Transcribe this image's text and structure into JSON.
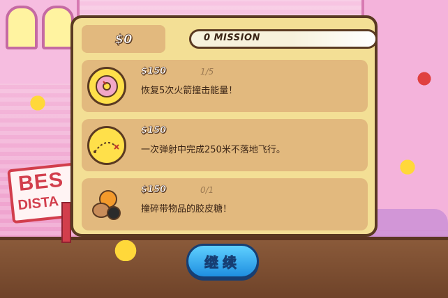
{
  "background_sign": {
    "line1": "BES",
    "line2": "DISTA"
  },
  "header": {
    "money": "$0",
    "missions_label": "0 MISSION"
  },
  "missions": [
    {
      "icon": "donut-icon",
      "reward": "$150",
      "progress": "1/5",
      "description": "恢复5次火箭撞击能量！"
    },
    {
      "icon": "trajectory-icon",
      "reward": "$150",
      "progress": "",
      "description": "一次弹射中完成250米不落地飞行。"
    },
    {
      "icon": "bomb-candy-icon",
      "reward": "$150",
      "progress": "0/1",
      "description": "撞碎带物品的胶皮糖！"
    }
  ],
  "continue_button": {
    "label": "继续"
  },
  "colors": {
    "panel": "#f3df95",
    "row": "#e2b97e",
    "outline": "#5a3a22",
    "button": "#2aa6ef"
  }
}
